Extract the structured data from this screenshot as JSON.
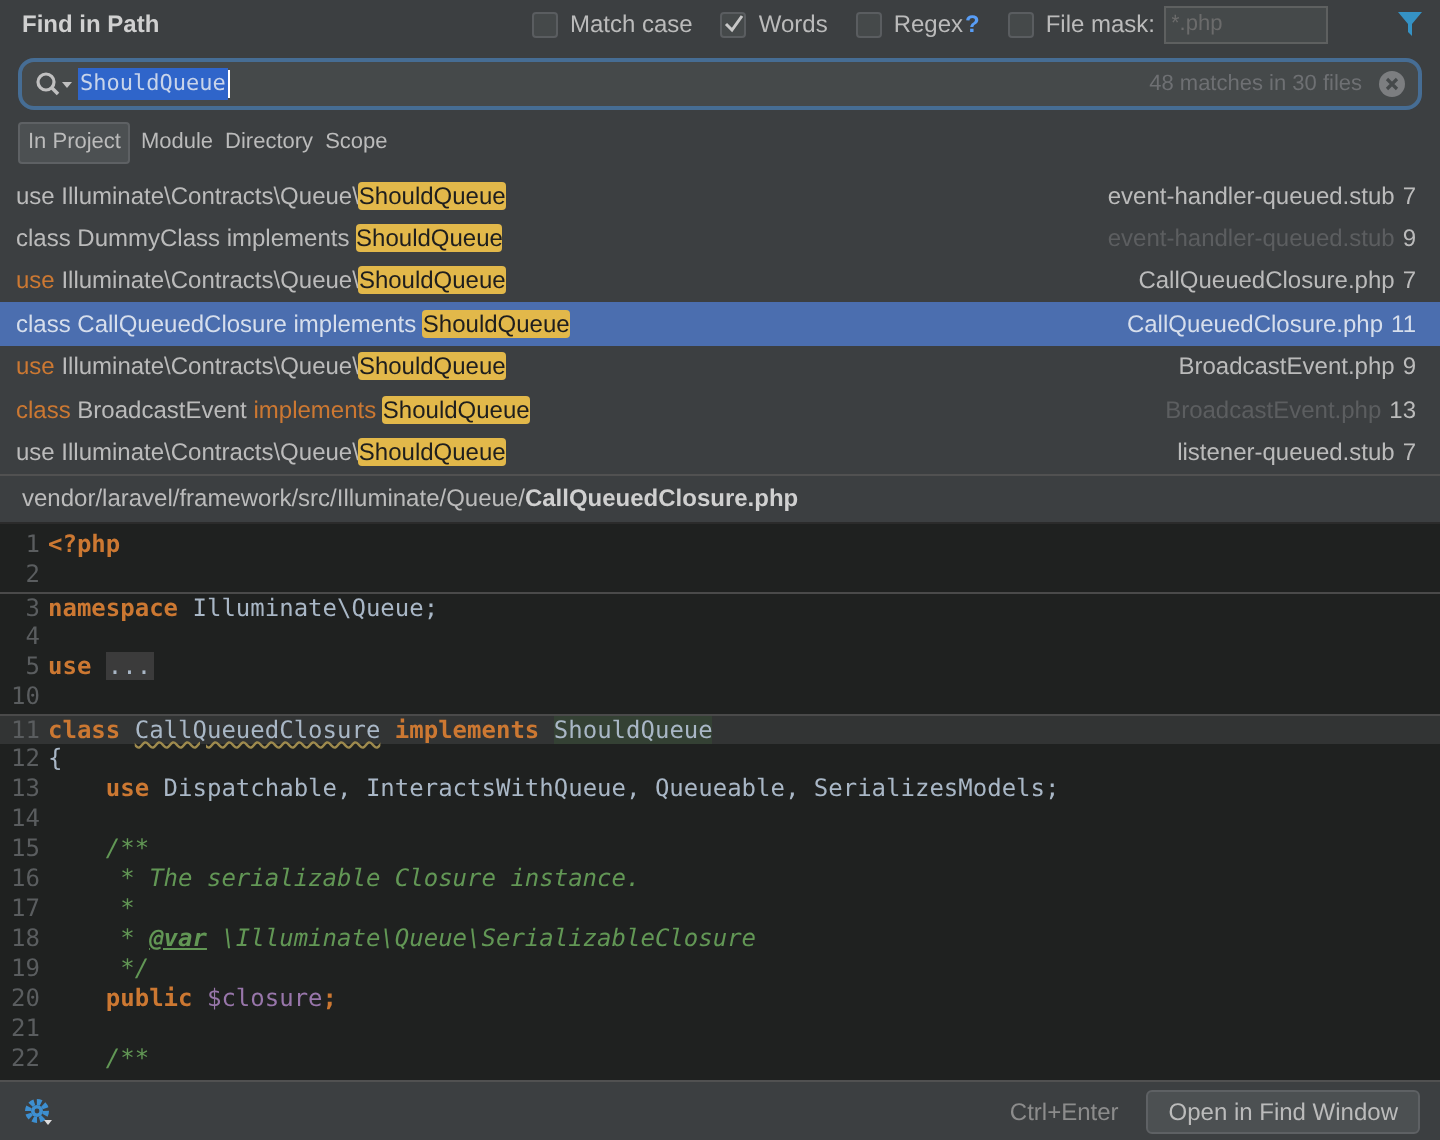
{
  "window": {
    "title": "Find in Path"
  },
  "options": [
    {
      "label": "Match case",
      "checked": false
    },
    {
      "label": "Words",
      "checked": true
    },
    {
      "label": "Regex",
      "checked": false,
      "help": "?"
    },
    {
      "label": "File mask:",
      "checked": false,
      "field_placeholder": "*.php"
    }
  ],
  "search": {
    "value": "ShouldQueue",
    "count": "48 matches in 30 files"
  },
  "scopes": [
    {
      "label": "In Project",
      "selected": true
    },
    {
      "label": "Module",
      "selected": false
    },
    {
      "label": "Directory",
      "selected": false
    },
    {
      "label": "Scope",
      "selected": false
    }
  ],
  "results": [
    {
      "selected": false,
      "segments": [
        {
          "text": "use Illuminate\\Contracts\\Queue\\",
          "kind": "plain"
        },
        {
          "text": "ShouldQueue",
          "kind": "match"
        }
      ],
      "file": "event-handler-queued.stub",
      "line": "7",
      "file_dimmed": false
    },
    {
      "selected": false,
      "segments": [
        {
          "text": "class DummyClass implements ",
          "kind": "plain"
        },
        {
          "text": "ShouldQueue",
          "kind": "match"
        }
      ],
      "file": "event-handler-queued.stub",
      "line": "9",
      "file_dimmed": true
    },
    {
      "selected": false,
      "segments": [
        {
          "text": "use",
          "kind": "keyword"
        },
        {
          "text": " Illuminate\\Contracts\\Queue\\",
          "kind": "plain"
        },
        {
          "text": "ShouldQueue",
          "kind": "match"
        }
      ],
      "file": "CallQueuedClosure.php",
      "line": "7",
      "file_dimmed": false
    },
    {
      "selected": true,
      "segments": [
        {
          "text": "class CallQueuedClosure implements ",
          "kind": "plain"
        },
        {
          "text": "ShouldQueue",
          "kind": "match"
        }
      ],
      "file": "CallQueuedClosure.php",
      "line": "11",
      "file_dimmed": false
    },
    {
      "selected": false,
      "segments": [
        {
          "text": "use",
          "kind": "keyword"
        },
        {
          "text": " Illuminate\\Contracts\\Queue\\",
          "kind": "plain"
        },
        {
          "text": "ShouldQueue",
          "kind": "match"
        }
      ],
      "file": "BroadcastEvent.php",
      "line": "9",
      "file_dimmed": false
    },
    {
      "selected": false,
      "segments": [
        {
          "text": "class",
          "kind": "keyword"
        },
        {
          "text": " BroadcastEvent ",
          "kind": "plain"
        },
        {
          "text": "implements ",
          "kind": "keyword"
        },
        {
          "text": "ShouldQueue",
          "kind": "match"
        }
      ],
      "file": "BroadcastEvent.php",
      "line": "13",
      "file_dimmed": true
    },
    {
      "selected": false,
      "segments": [
        {
          "text": "use Illuminate\\Contracts\\Queue\\",
          "kind": "plain"
        },
        {
          "text": "ShouldQueue",
          "kind": "match"
        }
      ],
      "file": "listener-queued.stub",
      "line": "7",
      "file_dimmed": false
    }
  ],
  "preview_path": {
    "dir": "vendor/laravel/framework/src/Illuminate/Queue/",
    "file": "CallQueuedClosure.php"
  },
  "code": [
    {
      "number": "1",
      "separator": false,
      "current": false,
      "segments": [
        {
          "text": "<?php",
          "kind": "keyword"
        }
      ]
    },
    {
      "number": "2",
      "separator": false,
      "current": false
    },
    {
      "number": "3",
      "separator": true,
      "current": false,
      "segments": [
        {
          "text": "namespace",
          "kind": "keyword"
        },
        {
          "text": " Illuminate\\Queue;",
          "kind": "plain"
        }
      ]
    },
    {
      "number": "4",
      "separator": false,
      "current": false
    },
    {
      "number": "5",
      "separator": false,
      "current": false,
      "segments": [
        {
          "text": "use ",
          "kind": "keyword"
        },
        {
          "text": "...",
          "kind": "folded"
        }
      ]
    },
    {
      "number": "10",
      "separator": false,
      "current": false
    },
    {
      "number": "11",
      "separator": true,
      "current": true,
      "segments": [
        {
          "text": "class ",
          "kind": "keyword"
        },
        {
          "text": "CallQueuedClosure",
          "kind": "underlined"
        },
        {
          "text": " implements ",
          "kind": "keyword"
        },
        {
          "text": "ShouldQueue",
          "kind": "usage"
        }
      ]
    },
    {
      "number": "12",
      "separator": false,
      "current": false,
      "segments": [
        {
          "text": "{",
          "kind": "plain"
        }
      ]
    },
    {
      "number": "13",
      "separator": false,
      "current": false,
      "segments": [
        {
          "text": "    use",
          "kind": "keyword"
        },
        {
          "text": " Dispatchable, InteractsWithQueue, Queueable, SerializesModels;",
          "kind": "plain"
        }
      ]
    },
    {
      "number": "14",
      "separator": false,
      "current": false
    },
    {
      "number": "15",
      "separator": false,
      "current": false,
      "segments": [
        {
          "text": "    /**",
          "kind": "comment"
        }
      ]
    },
    {
      "number": "16",
      "separator": false,
      "current": false,
      "segments": [
        {
          "text": "     * The serializable Closure instance.",
          "kind": "comment"
        }
      ]
    },
    {
      "number": "17",
      "separator": false,
      "current": false,
      "segments": [
        {
          "text": "     *",
          "kind": "comment"
        }
      ]
    },
    {
      "number": "18",
      "separator": false,
      "current": false,
      "segments": [
        {
          "text": "     * ",
          "kind": "comment"
        },
        {
          "text": "@var",
          "kind": "doctag"
        },
        {
          "text": " \\Illuminate\\Queue\\SerializableClosure",
          "kind": "comment"
        }
      ]
    },
    {
      "number": "19",
      "separator": false,
      "current": false,
      "segments": [
        {
          "text": "     */",
          "kind": "comment"
        }
      ]
    },
    {
      "number": "20",
      "separator": false,
      "current": false,
      "segments": [
        {
          "text": "    public ",
          "kind": "keyword"
        },
        {
          "text": "$closure",
          "kind": "variable"
        },
        {
          "text": ";",
          "kind": "keyword"
        }
      ]
    },
    {
      "number": "21",
      "separator": false,
      "current": false
    },
    {
      "number": "22",
      "separator": false,
      "current": false,
      "segments": [
        {
          "text": "    /**",
          "kind": "comment"
        }
      ]
    }
  ],
  "footer": {
    "shortcut": "Ctrl+Enter",
    "button": "Open in Find Window"
  }
}
